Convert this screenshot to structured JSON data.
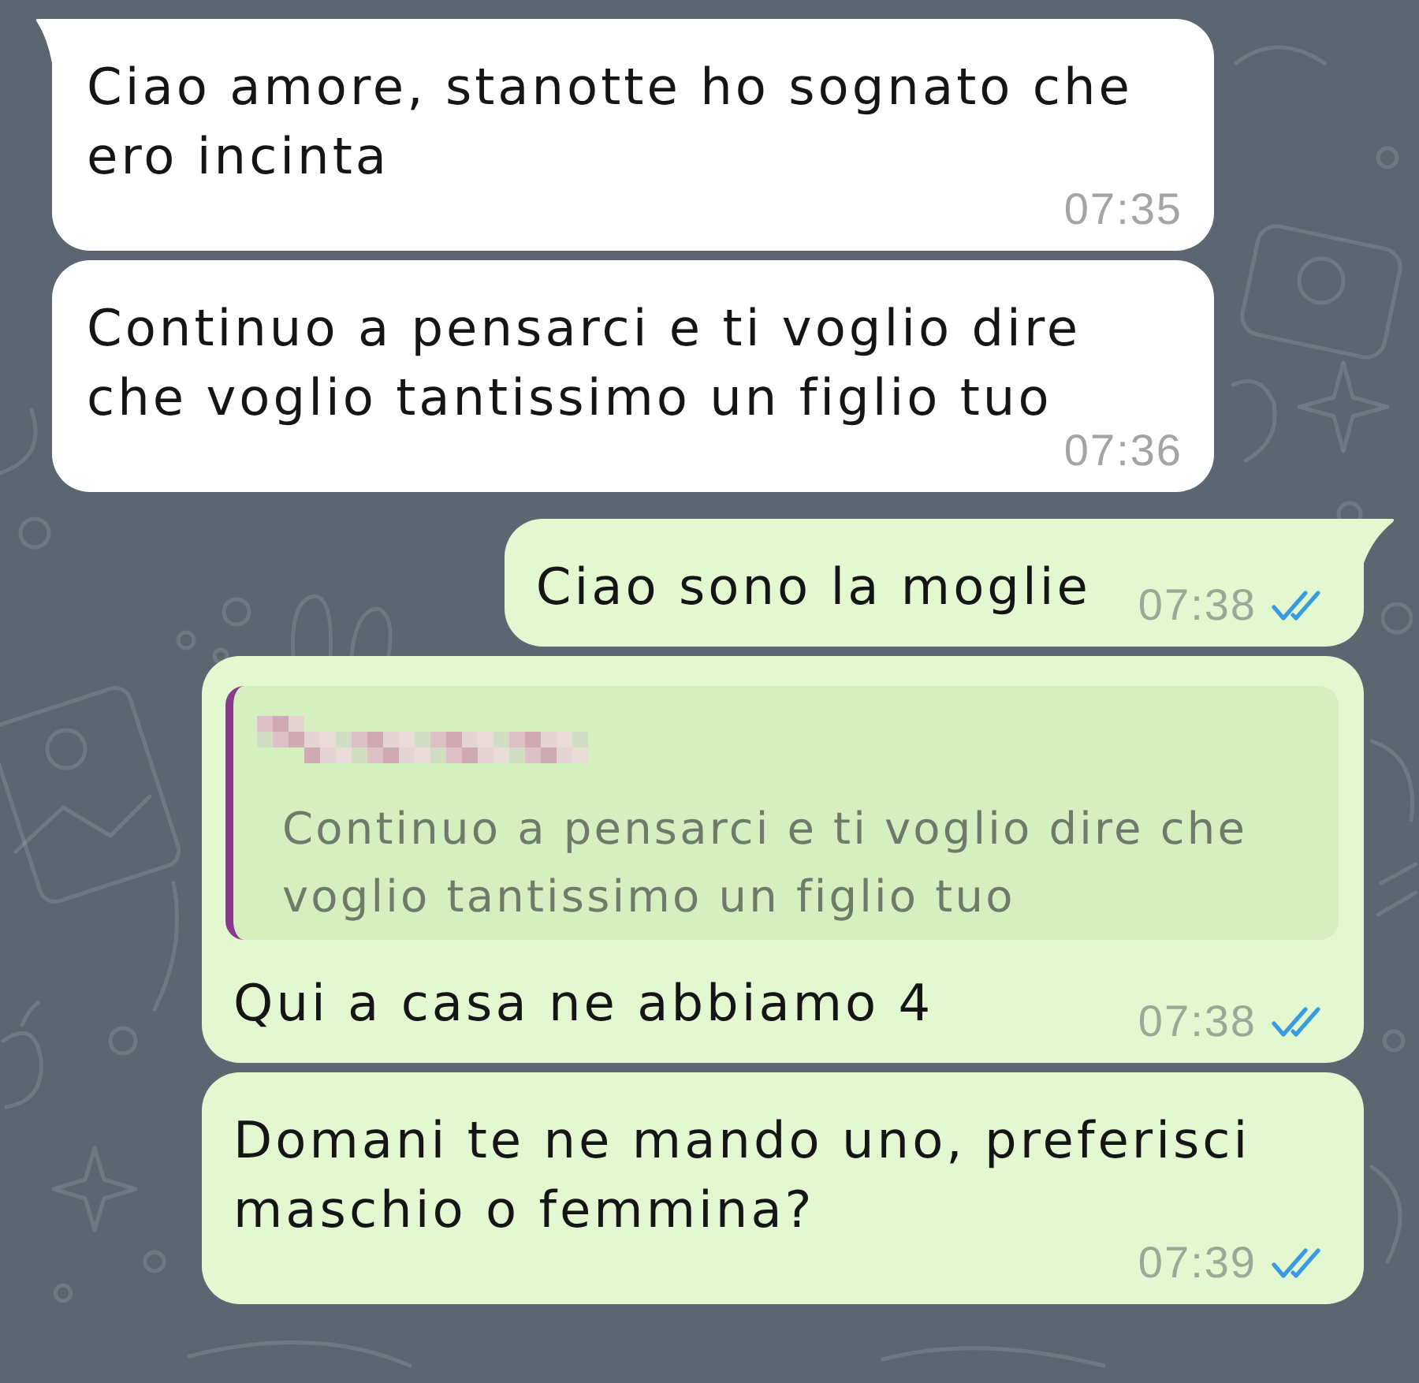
{
  "messages": [
    {
      "kind": "incoming",
      "tail": true,
      "text": "Ciao amore, stanotte ho sognato che ero incinta",
      "time": "07:35"
    },
    {
      "kind": "incoming",
      "tail": false,
      "text": "Continuo a pensarci e ti voglio dire che voglio tantissimo un figlio tuo",
      "time": "07:36"
    },
    {
      "kind": "outgoing",
      "tail": true,
      "text": "Ciao sono la moglie",
      "time": "07:38",
      "read": true
    },
    {
      "kind": "outgoing",
      "tail": false,
      "quote": {
        "text": "Continuo a pensarci e ti voglio dire che voglio tantissimo un figlio tuo"
      },
      "text": "Qui a casa ne abbiamo 4",
      "time": "07:38",
      "read": true
    },
    {
      "kind": "outgoing",
      "tail": false,
      "text": "Domani te ne mando uno, preferisci maschio o femmina?",
      "time": "07:39",
      "read": true
    }
  ]
}
